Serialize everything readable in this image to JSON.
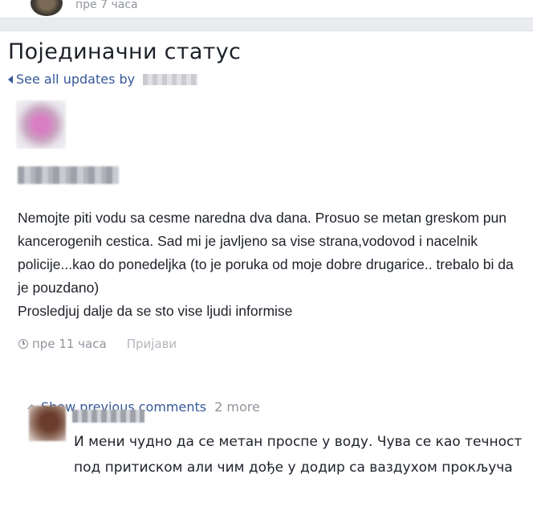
{
  "previous_post": {
    "time_text": "пре 7 часа"
  },
  "page": {
    "title": "Појединачни статус",
    "see_all_label": "See all updates by"
  },
  "post": {
    "text": "Nemojte piti vodu sa cesme naredna dva dana. Prosuo se metan greskom pun kancerogenih cestica. Sad mi je javljeno sa vise strana,vodovod i nacelnik policije...kao do ponedeljka (to je poruka od moje dobre drugarice.. trebalo bi da je pouzdano)\nProsledjuj dalje da se sto vise ljudi informise",
    "time": "пре 11 часа",
    "report_label": "Пријави"
  },
  "comments": {
    "show_previous_label": "Show previous comments",
    "more_count": "2 more",
    "items": [
      {
        "text": "И мени чудно да се метан проспе у воду. Чува се као течност под притиском али чим дође у додир са ваздухом прокључа"
      }
    ]
  },
  "icons": {
    "back": "caret-left-icon",
    "time": "clock-icon",
    "expand": "chevron-up-icon"
  },
  "colors": {
    "link": "#365899",
    "muted": "#90949c",
    "text": "#1d2129",
    "background": "#e9ebee"
  }
}
